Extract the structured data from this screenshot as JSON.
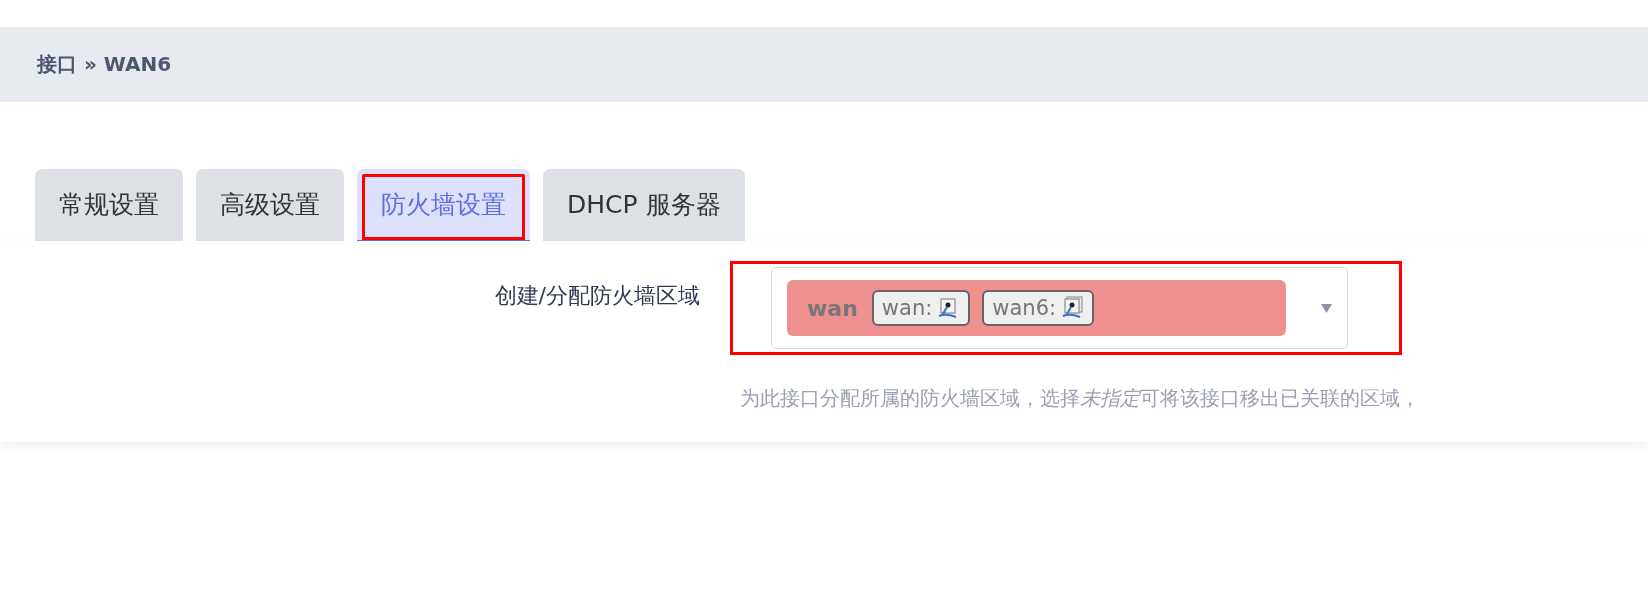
{
  "breadcrumb": {
    "parent": "接口",
    "separator": "»",
    "current": "WAN6"
  },
  "tabs": [
    {
      "label": "常规设置",
      "selected": false,
      "annotated": false
    },
    {
      "label": "高级设置",
      "selected": false,
      "annotated": false
    },
    {
      "label": "防火墙设置",
      "selected": true,
      "annotated": true
    },
    {
      "label": "DHCP 服务器",
      "selected": false,
      "annotated": false
    }
  ],
  "field": {
    "label": "创建/分配防火墙区域",
    "annotated": true,
    "zone": {
      "name": "wan",
      "color": "#ee9090",
      "networks": [
        "wan:",
        "wan6:"
      ]
    },
    "hint": [
      {
        "text": "为此接口分配所属的防火墙区域，选择",
        "italic": false
      },
      {
        "text": "未指定",
        "italic": true
      },
      {
        "text": "可将该接口移出已关联的区域，",
        "italic": false
      }
    ]
  }
}
